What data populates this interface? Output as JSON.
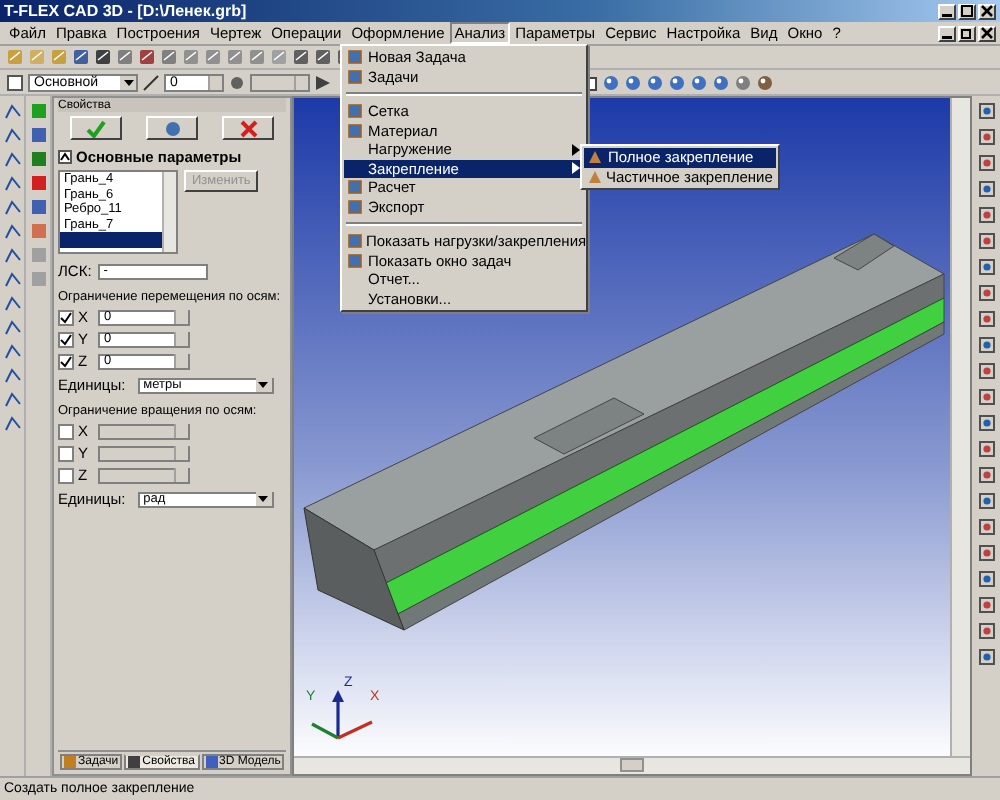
{
  "window": {
    "title": "T-FLEX CAD 3D - [D:\\Ленек.grb]"
  },
  "menu_bar": [
    {
      "label": "Файл",
      "selected": false
    },
    {
      "label": "Правка",
      "selected": false
    },
    {
      "label": "Построения",
      "selected": false
    },
    {
      "label": "Чертеж",
      "selected": false
    },
    {
      "label": "Операции",
      "selected": false
    },
    {
      "label": "Оформление",
      "selected": false
    },
    {
      "label": "Анализ",
      "selected": true
    },
    {
      "label": "Параметры",
      "selected": false
    },
    {
      "label": "Сервис",
      "selected": false
    },
    {
      "label": "Настройка",
      "selected": false
    },
    {
      "label": "Вид",
      "selected": false
    },
    {
      "label": "Окно",
      "selected": false
    },
    {
      "label": "?",
      "selected": false
    }
  ],
  "toolbar": {
    "style_combo": "Основной",
    "layer_field": "0"
  },
  "analysis_menu": [
    {
      "kind": "item",
      "label": "Новая Задача",
      "icon": true,
      "submenu": false,
      "selected": false
    },
    {
      "kind": "item",
      "label": "Задачи",
      "icon": true,
      "submenu": false,
      "selected": false
    },
    {
      "kind": "separator"
    },
    {
      "kind": "item",
      "label": "Сетка",
      "icon": true,
      "submenu": false,
      "selected": false
    },
    {
      "kind": "item",
      "label": "Материал",
      "icon": true,
      "submenu": false,
      "selected": false
    },
    {
      "kind": "item",
      "label": "Нагружение",
      "icon": false,
      "submenu": true,
      "selected": false
    },
    {
      "kind": "item",
      "label": "Закрепление",
      "icon": false,
      "submenu": true,
      "selected": true
    },
    {
      "kind": "item",
      "label": "Расчет",
      "icon": true,
      "submenu": false,
      "selected": false
    },
    {
      "kind": "item",
      "label": "Экспорт",
      "icon": true,
      "submenu": false,
      "selected": false
    },
    {
      "kind": "separator"
    },
    {
      "kind": "item",
      "label": "Показать нагрузки/закрепления",
      "icon": true,
      "submenu": false,
      "selected": false
    },
    {
      "kind": "item",
      "label": "Показать окно задач",
      "icon": true,
      "submenu": false,
      "selected": false
    },
    {
      "kind": "item",
      "label": "Отчет...",
      "icon": false,
      "submenu": false,
      "selected": false
    },
    {
      "kind": "item",
      "label": "Установки...",
      "icon": false,
      "submenu": false,
      "selected": false
    }
  ],
  "submenu": [
    {
      "label": "Полное закрепление",
      "selected": true
    },
    {
      "label": "Частичное закрепление",
      "selected": false
    }
  ],
  "properties": {
    "title": "Свойства",
    "section": "Основные параметры",
    "elements": [
      {
        "label": "Грань_4",
        "selected": false
      },
      {
        "label": "Грань_6",
        "selected": false
      },
      {
        "label": "Ребро_11",
        "selected": false
      },
      {
        "label": "Грань_7",
        "selected": false
      },
      {
        "selected": true
      }
    ],
    "change_button": {
      "label": "Изменить",
      "disabled": true
    },
    "lsk": {
      "label": "ЛСК:",
      "value": "-"
    },
    "translation": {
      "title": "Ограничение перемещения по осям:",
      "units_label": "Единицы:",
      "units": "метры",
      "axes": [
        {
          "label": "X",
          "checked": true,
          "value": "0"
        },
        {
          "label": "Y",
          "checked": true,
          "value": "0"
        },
        {
          "label": "Z",
          "checked": true,
          "value": "0"
        }
      ]
    },
    "rotation": {
      "title": "Ограничение вращения по осям:",
      "units_label": "Единицы:",
      "units": "рад",
      "axes": [
        {
          "label": "X",
          "checked": false
        },
        {
          "label": "Y",
          "checked": false
        },
        {
          "label": "Z",
          "checked": false
        }
      ]
    },
    "tabs": [
      {
        "label": "Задачи",
        "selected": false
      },
      {
        "label": "Свойства",
        "selected": true
      },
      {
        "label": "3D Модель",
        "selected": false
      }
    ]
  },
  "axis_triad": {
    "x": "X",
    "y": "Y",
    "z": "Z"
  },
  "status_bar": "Создать полное закрепление"
}
